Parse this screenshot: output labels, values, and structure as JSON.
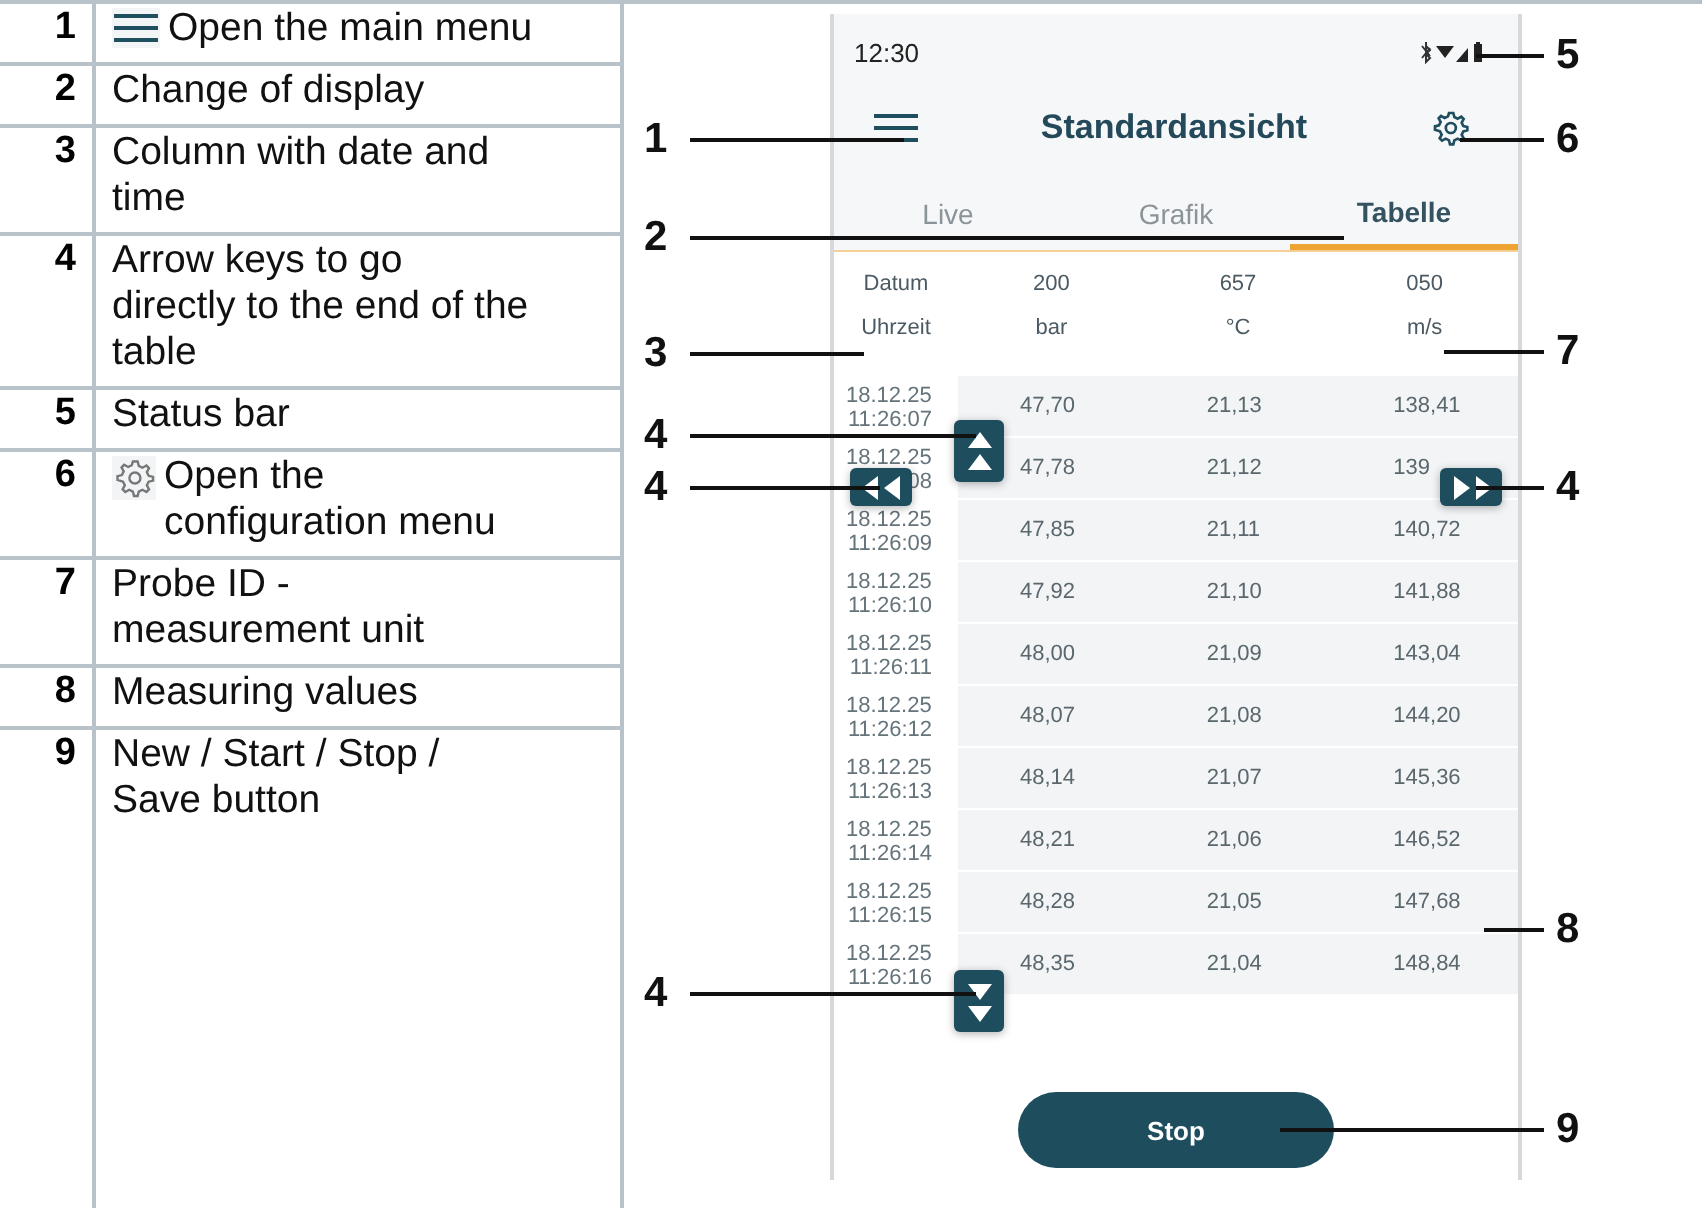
{
  "legend": [
    {
      "number": "1",
      "text": "Open the main menu"
    },
    {
      "number": "2",
      "text": "Change of display"
    },
    {
      "number": "3",
      "text": "Column with date and time"
    },
    {
      "number": "4",
      "text": "Arrow keys to go directly to the end of the table"
    },
    {
      "number": "5",
      "text": "Status bar"
    },
    {
      "number": "6",
      "text": "Open the configuration menu"
    },
    {
      "number": "7",
      "text": "Probe ID - measurement unit"
    },
    {
      "number": "8",
      "text": "Measuring values"
    },
    {
      "number": "9",
      "text": "New / Start / Stop / Save button"
    }
  ],
  "phone": {
    "time": "12:30",
    "title": "Standardansicht",
    "tabs": [
      {
        "label": "Live",
        "selected": false
      },
      {
        "label": "Grafik",
        "selected": false
      },
      {
        "label": "Tabelle",
        "selected": true
      }
    ],
    "columns": [
      {
        "id": "Datum",
        "unit": "Uhrzeit"
      },
      {
        "id": "200",
        "unit": "bar"
      },
      {
        "id": "657",
        "unit": "°C"
      },
      {
        "id": "050",
        "unit": "m/s"
      }
    ],
    "rows": [
      {
        "date": "18.12.25",
        "time": "11:26:07",
        "values": [
          "47,70",
          "21,13",
          "138,41"
        ]
      },
      {
        "date": "18.12.25",
        "time": "08",
        "values": [
          "47,78",
          "21,12",
          "139"
        ]
      },
      {
        "date": "18.12.25",
        "time": "11:26:09",
        "values": [
          "47,85",
          "21,11",
          "140,72"
        ]
      },
      {
        "date": "18.12.25",
        "time": "11:26:10",
        "values": [
          "47,92",
          "21,10",
          "141,88"
        ]
      },
      {
        "date": "18.12.25",
        "time": "11:26:11",
        "values": [
          "48,00",
          "21,09",
          "143,04"
        ]
      },
      {
        "date": "18.12.25",
        "time": "11:26:12",
        "values": [
          "48,07",
          "21,08",
          "144,20"
        ]
      },
      {
        "date": "18.12.25",
        "time": "11:26:13",
        "values": [
          "48,14",
          "21,07",
          "145,36"
        ]
      },
      {
        "date": "18.12.25",
        "time": "11:26:14",
        "values": [
          "48,21",
          "21,06",
          "146,52"
        ]
      },
      {
        "date": "18.12.25",
        "time": "11:26:15",
        "values": [
          "48,28",
          "21,05",
          "147,68"
        ]
      },
      {
        "date": "18.12.25",
        "time": "11:26:16",
        "values": [
          "48,35",
          "21,04",
          "148,84"
        ]
      }
    ],
    "button": "Stop"
  },
  "callouts": [
    {
      "label": "1"
    },
    {
      "label": "2"
    },
    {
      "label": "3"
    },
    {
      "label": "4"
    },
    {
      "label": "4"
    },
    {
      "label": "4"
    },
    {
      "label": "5"
    },
    {
      "label": "6"
    },
    {
      "label": "7"
    },
    {
      "label": "4"
    },
    {
      "label": "8"
    },
    {
      "label": "9"
    }
  ]
}
